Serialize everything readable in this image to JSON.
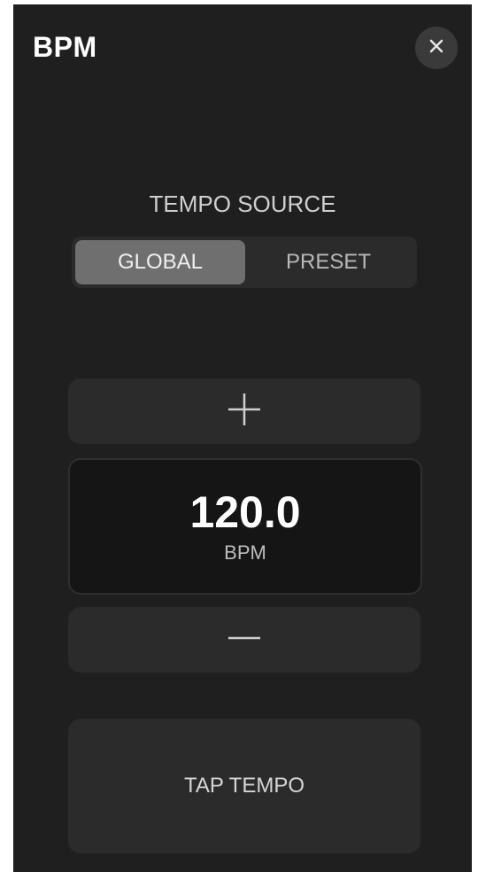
{
  "header": {
    "title": "BPM",
    "close_icon": "close-icon"
  },
  "tempo_source": {
    "label": "TEMPO SOURCE",
    "options": [
      {
        "label": "GLOBAL",
        "selected": true
      },
      {
        "label": "PRESET",
        "selected": false
      }
    ]
  },
  "tempo": {
    "increment_icon": "plus-icon",
    "value": "120.0",
    "unit": "BPM",
    "decrement_icon": "minus-icon"
  },
  "tap": {
    "label": "TAP TEMPO"
  },
  "colors": {
    "panel_bg": "#1f1f1f",
    "control_bg": "#2b2b2b",
    "selected_segment": "#6f6f6f",
    "display_bg": "#151515",
    "text_primary": "#ffffff"
  }
}
